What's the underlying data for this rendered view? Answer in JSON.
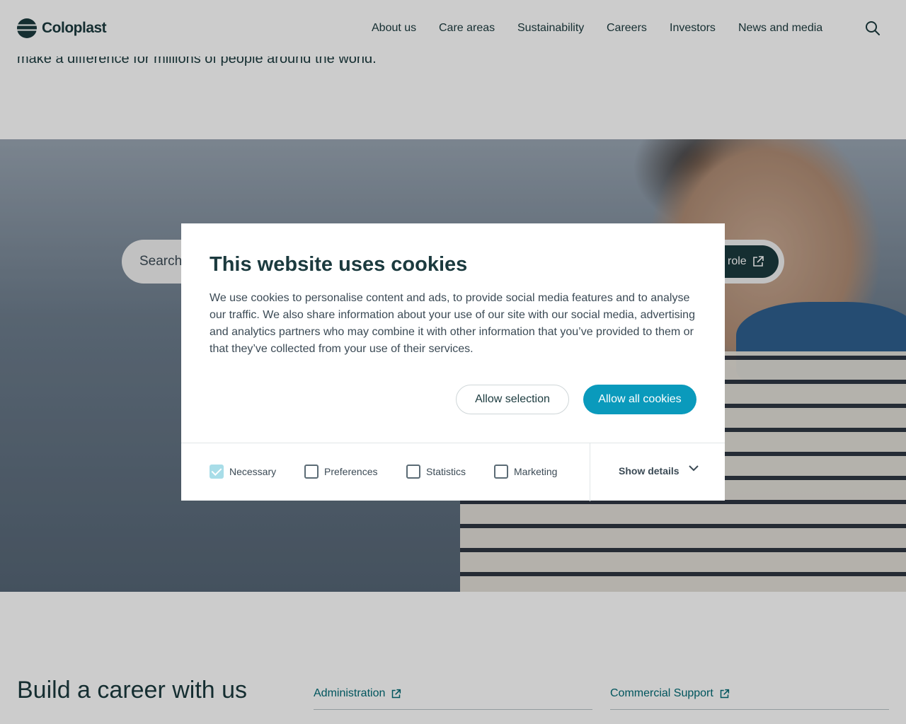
{
  "header": {
    "brand": "Coloplast",
    "nav": [
      "About us",
      "Care areas",
      "Sustainability",
      "Careers",
      "Investors",
      "News and media"
    ]
  },
  "intro": {
    "text": "make a difference for millions of people around the world."
  },
  "hero": {
    "search_placeholder": "Search",
    "role_button": "role"
  },
  "careers": {
    "title": "Build a career with us",
    "links_col1": [
      "Administration"
    ],
    "links_col2": [
      "Commercial Support"
    ]
  },
  "cookie_dialog": {
    "title": "This website uses cookies",
    "body": "We use cookies to personalise content and ads, to provide social media features and to analyse our traffic. We also share information about your use of our site with our social media, advertising and analytics partners who may combine it with other information that you’ve provided to them or that they’ve collected from your use of their services.",
    "allow_selection": "Allow selection",
    "allow_all": "Allow all cookies",
    "options": [
      {
        "label": "Necessary",
        "checked": true
      },
      {
        "label": "Preferences",
        "checked": false
      },
      {
        "label": "Statistics",
        "checked": false
      },
      {
        "label": "Marketing",
        "checked": false
      }
    ],
    "show_details": "Show details"
  },
  "colors": {
    "brand_dark": "#1b3a3e",
    "accent": "#0a9abc",
    "link": "#006b75"
  }
}
